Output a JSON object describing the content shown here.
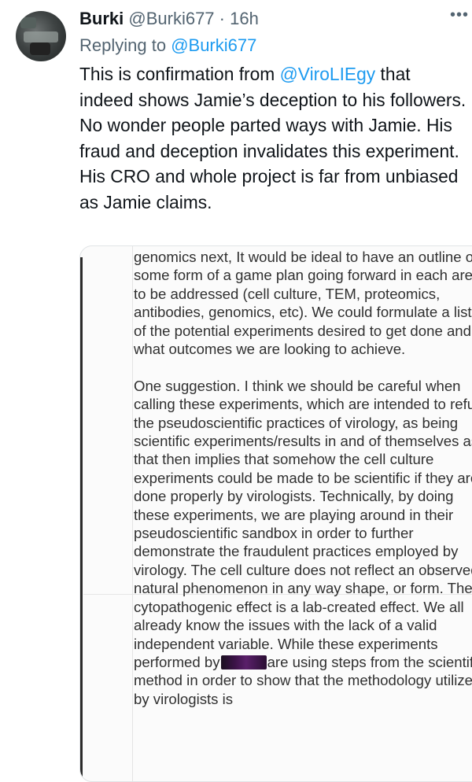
{
  "post": {
    "author_name": "Burki",
    "author_handle": "@Burki677",
    "separator": "·",
    "timestamp": "16h",
    "more_icon": "more-horizontal-icon",
    "replying_to_prefix": "Replying to ",
    "replying_to_handle": "@Burki677",
    "text_part1": "This is confirmation from ",
    "text_mention": "@ViroLIEgy",
    "text_part2": " that indeed shows Jamie’s deception to his followers. No wonder people parted ways with Jamie. His fraud and deception invalidates this experiment. His CRO and whole project is far from unbiased as Jamie claims."
  },
  "attachment": {
    "paragraph1": "genomics next, It would be ideal to have an outline or some form of a game plan going forward in each area to be addressed (cell culture, TEM, proteomics, antibodies, genomics, etc). We could formulate a list of the potential experiments desired to get done and what outcomes we are looking to achieve.",
    "paragraph2": "One suggestion. I think we should be careful when calling these experiments, which are intended to refute the pseudoscientific practices of virology, as being scientific experiments/results in and of themselves as that then implies that somehow the cell culture experiments could be made to be scientific if they are done properly by virologists. Technically, by doing these experiments, we are playing around in their pseudoscientific sandbox in order to further demonstrate the fraudulent practices employed by virology. The cell culture does not reflect an observed natural phenomenon in any way shape, or form. The cytopathogenic effect is a lab-created effect. We all already know the issues with the lack of a valid independent variable. While these experiments performed by",
    "paragraph2_end": "are using steps from the scientific method in order to show that the methodology utilized by virologists is"
  }
}
